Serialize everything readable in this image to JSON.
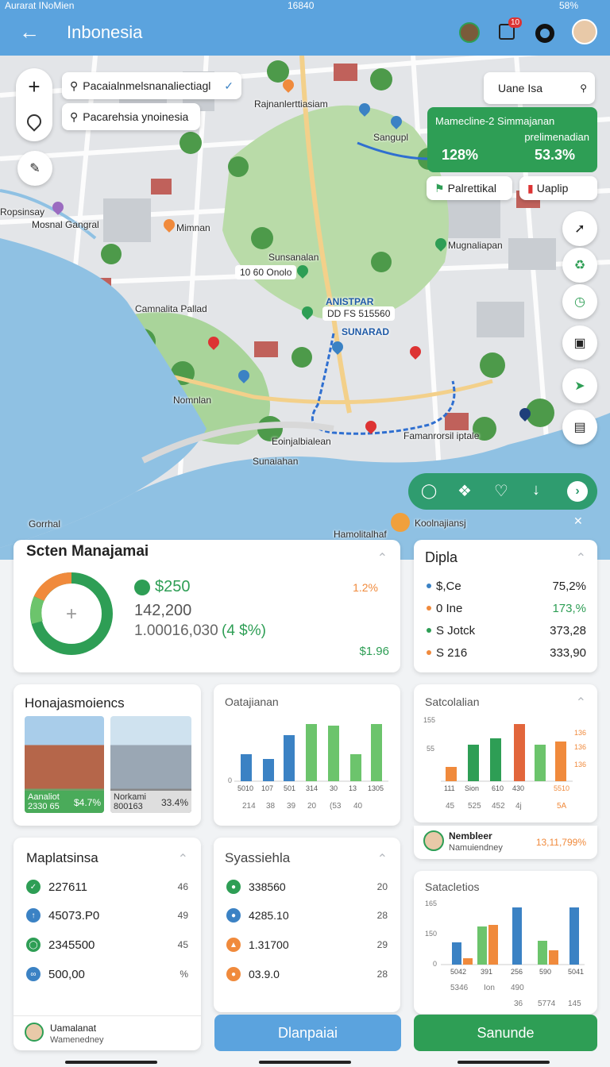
{
  "status_bar": {
    "left": "Aurarat INoMien",
    "time": "16840",
    "battery": "58%"
  },
  "header": {
    "title": "Inbonesia",
    "notif_count": "10"
  },
  "search": {
    "primary": "Pacaialnmelsnanaliectiagl",
    "secondary": "Pacarehsia ynoinesia",
    "right_search": "Uane Isa"
  },
  "info_card": {
    "title": "Mamecline-2 Simmajanan",
    "value_left": "128%",
    "label_right": "prelimenadian",
    "value_right": "53.3%",
    "btn_left": "Palrettikal",
    "btn_right": "Uaplip"
  },
  "map_labels": {
    "l1": "Rajnanlerttiasiam",
    "l2": "Sangupl",
    "l3": "Ropsinsay",
    "l4": "Mosnal Gangral",
    "l5": "Mimnan",
    "l6": "Sunsanalan",
    "l7": "10 60 Onolo",
    "l8": "Mugnaliapan",
    "l9": "Camnalita Pallad",
    "l10": "ANISTPAR",
    "l11": "DD FS 515560",
    "l12": "SUNARAD",
    "l13": "Nomnlan",
    "l14": "Eoinjalbialean",
    "l15": "Sunaiahan",
    "l16": "Famanrorsil iptale",
    "l17": "Gorrhal",
    "l18": "Hamolitalhaf",
    "l19": "Koolnajiansj"
  },
  "panel1": {
    "title": "Scten Manajamai",
    "val1": "$250",
    "pct1": "1.2%",
    "val2": "142,200",
    "val3": "1.00016,030",
    "val3b": "(4 $%)",
    "val4": "$1.96"
  },
  "panel2": {
    "title": "Dipla",
    "items": [
      {
        "label": "$,Ce",
        "value": "75,2%",
        "color": "#3b82c4"
      },
      {
        "label": "0 Ine",
        "value": "173,%",
        "color": "#f08a3c"
      },
      {
        "label": "S Jotck",
        "value": "373,28",
        "color": "#2e9e55"
      },
      {
        "label": "S 216",
        "value": "333,90",
        "color": "#f08a3c"
      }
    ]
  },
  "panel3": {
    "title": "Honajasmoiencs",
    "img1_label": "Aanaliot",
    "img1_sub": "2330 65",
    "img1_val": "$4.7%",
    "img2_label": "Norkami",
    "img2_sub": "800163",
    "img2_val": "33.4%"
  },
  "panel4": {
    "title": "Oatajianan",
    "x_labels": [
      "5010",
      "107",
      "501",
      "314",
      "30",
      "13",
      "1305"
    ],
    "sub_labels": [
      "214",
      "38",
      "39",
      "20",
      "(53",
      "40"
    ],
    "y_zero": "0"
  },
  "panel5": {
    "title": "Satcolalian",
    "y_top": "155",
    "y_mid": "55",
    "right_a": "136",
    "right_b": "136",
    "right_c": "136",
    "x_labels": [
      "111",
      "Sion",
      "610",
      "430",
      "5510"
    ],
    "sub_labels": [
      "45",
      "525",
      "452",
      "4j",
      "5A"
    ]
  },
  "member": {
    "name": "Nembleer",
    "sub": "Namuiendney",
    "value": "13,11,799%"
  },
  "panel6": {
    "title": "Maplatsinsa",
    "items": [
      {
        "label": "227611",
        "value": "46",
        "color": "#2e9e55"
      },
      {
        "label": "45073.P0",
        "value": "49",
        "color": "#3b82c4"
      },
      {
        "label": "2345500",
        "value": "45",
        "color": "#2e9e55"
      },
      {
        "label": "500,00",
        "value": "%",
        "color": "#3b82c4"
      }
    ]
  },
  "panel7": {
    "title": "Syassiehla",
    "items": [
      {
        "label": "338560",
        "value": "20",
        "color": "#2e9e55"
      },
      {
        "label": "4285.10",
        "value": "28",
        "color": "#3b82c4"
      },
      {
        "label": "1.31700",
        "value": "29",
        "color": "#f08a3c"
      },
      {
        "label": "03.9.0",
        "value": "28",
        "color": "#f08a3c"
      }
    ]
  },
  "panel8": {
    "title": "Satacletios",
    "y_top": "165",
    "y_mid": "150",
    "y_zero": "0",
    "x_labels": [
      "5042",
      "391",
      "256",
      "590",
      "5041"
    ],
    "sub_labels": [
      "5346",
      "Ion",
      "490"
    ],
    "foot": [
      "36",
      "5774",
      "145"
    ]
  },
  "footer": {
    "user": "Uamalanat",
    "user_sub": "Wamenedney",
    "btn_mid": "Dlanpaiai",
    "btn_right": "Sanunde"
  },
  "colors": {
    "header": "#5ba3de",
    "green": "#2e9e55",
    "blue": "#3b82c4",
    "orange": "#f08a3c",
    "lightgreen": "#6cc46c"
  }
}
